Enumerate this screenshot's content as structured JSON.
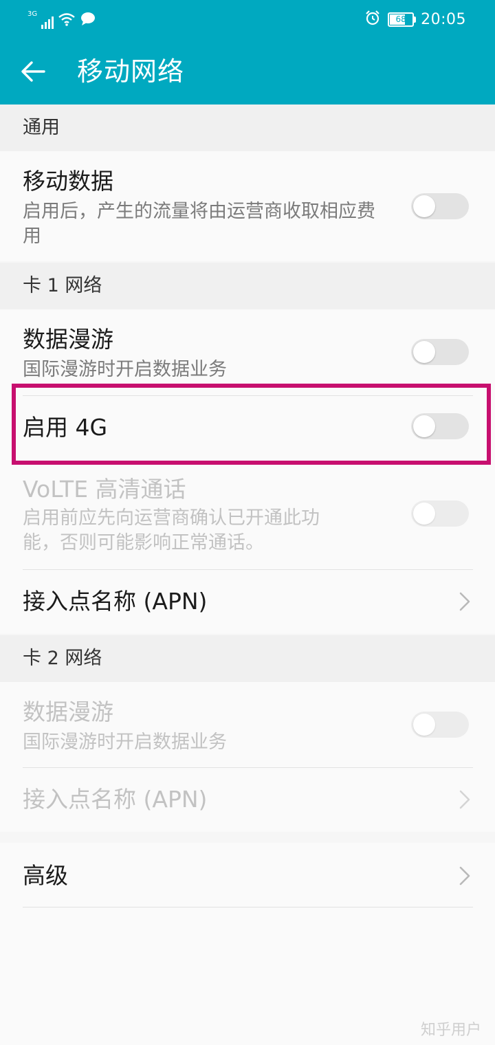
{
  "status_bar": {
    "network_type": "3G",
    "time": "20:05",
    "battery_level": "68",
    "icons": [
      "signal-icon",
      "wifi-icon",
      "chat-bubble-icon",
      "alarm-icon",
      "battery-icon"
    ]
  },
  "header": {
    "title": "移动网络",
    "back_icon": "back-arrow-icon",
    "background_color": "#00a9c0"
  },
  "sections": {
    "general": {
      "label": "通用",
      "mobile_data": {
        "title": "移动数据",
        "subtitle": "启用后，产生的流量将由运营商收取相应费用",
        "enabled": false
      }
    },
    "sim1": {
      "label": "卡 1 网络",
      "data_roaming": {
        "title": "数据漫游",
        "subtitle": "国际漫游时开启数据业务",
        "enabled": false
      },
      "enable_4g": {
        "title": "启用 4G",
        "enabled": false,
        "highlight_color": "#c70f6f"
      },
      "volte": {
        "title": "VoLTE 高清通话",
        "subtitle": "启用前应先向运营商确认已开通此功能，否则可能影响正常通话。",
        "enabled": false,
        "disabled": true
      },
      "apn": {
        "title": "接入点名称 (APN)"
      }
    },
    "sim2": {
      "label": "卡 2 网络",
      "data_roaming": {
        "title": "数据漫游",
        "subtitle": "国际漫游时开启数据业务",
        "enabled": false,
        "disabled": true
      },
      "apn": {
        "title": "接入点名称 (APN)",
        "disabled": true
      }
    },
    "advanced": {
      "title": "高级"
    }
  },
  "watermark": "知乎用户"
}
